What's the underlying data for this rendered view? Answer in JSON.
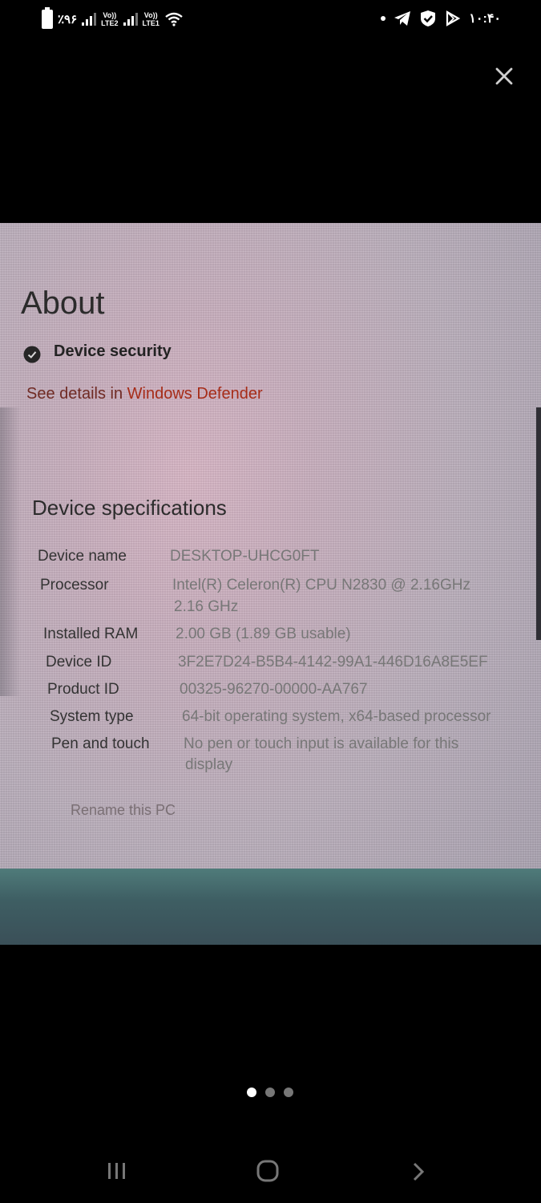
{
  "status_bar": {
    "battery": "٪۹۶",
    "sim1": "LTE2",
    "sim2": "LTE1",
    "volte": "Vo))",
    "time": "۱۰:۴۰"
  },
  "viewer": {
    "close_icon": "close-icon",
    "page_count": 3,
    "active_page": 1
  },
  "about": {
    "title": "About",
    "security_label": "Device security",
    "details_prefix": "See details in ",
    "details_link": "Windows Defender"
  },
  "specs": {
    "title": "Device specifications",
    "rows": [
      {
        "label": "Device name",
        "value": "DESKTOP-UHCG0FT"
      },
      {
        "label": "Processor",
        "value": "Intel(R) Celeron(R) CPU  N2830  @ 2.16GHz"
      },
      {
        "label": "",
        "value": "2.16 GHz"
      },
      {
        "label": "Installed RAM",
        "value": "2.00 GB (1.89 GB usable)"
      },
      {
        "label": "Device ID",
        "value": "3F2E7D24-B5B4-4142-99A1-446D16A8E5EF"
      },
      {
        "label": "Product ID",
        "value": "00325-96270-00000-AA767"
      },
      {
        "label": "System type",
        "value": "64-bit operating system, x64-based processor"
      },
      {
        "label": "Pen and touch",
        "value": "No pen or touch input is available for this"
      },
      {
        "label": "",
        "value": "display"
      }
    ],
    "rename": "Rename this PC"
  }
}
